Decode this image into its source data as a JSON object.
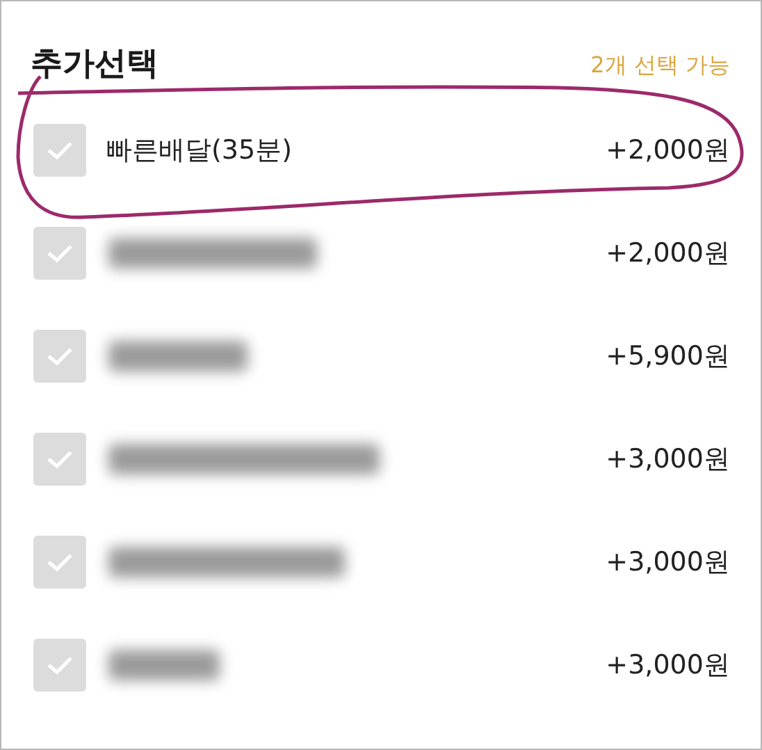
{
  "section": {
    "title": "추가선택",
    "hint": "2개 선택 가능"
  },
  "options": [
    {
      "kind": "text",
      "label": "빠른배달(35분)",
      "price": "+2,000원",
      "checked": false,
      "circled": true
    },
    {
      "kind": "redacted",
      "price": "+2,000원",
      "checked": false
    },
    {
      "kind": "redacted",
      "price": "+5,900원",
      "checked": false
    },
    {
      "kind": "redacted",
      "price": "+3,000원",
      "checked": false
    },
    {
      "kind": "redacted",
      "price": "+3,000원",
      "checked": false
    },
    {
      "kind": "redacted",
      "price": "+3,000원",
      "checked": false
    }
  ]
}
